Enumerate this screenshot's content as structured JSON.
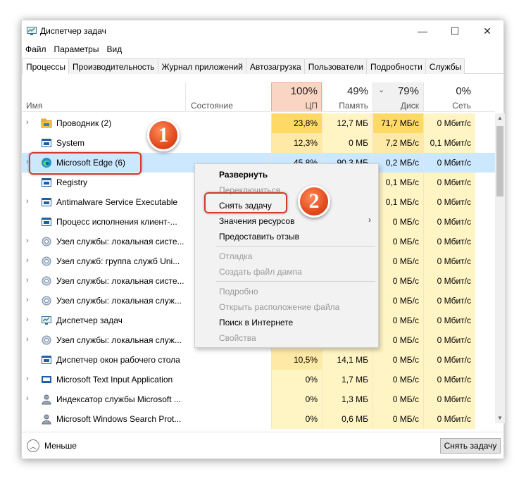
{
  "window": {
    "title": "Диспетчер задач",
    "minimize": "—",
    "maximize": "☐",
    "close": "✕"
  },
  "menu": [
    "Файл",
    "Параметры",
    "Вид"
  ],
  "tabs": [
    "Процессы",
    "Производительность",
    "Журнал приложений",
    "Автозагрузка",
    "Пользователи",
    "Подробности",
    "Службы"
  ],
  "header": {
    "name": "Имя",
    "state": "Состояние",
    "cpu_pct": "100%",
    "cpu": "ЦП",
    "mem_pct": "49%",
    "mem": "Память",
    "disk_pct": "79%",
    "disk": "Диск",
    "net_pct": "0%",
    "net": "Сеть",
    "sort_icon": "chevron-down"
  },
  "rows": [
    {
      "name": "Проводник (2)",
      "icon": "explorer-icon",
      "expand": true,
      "cpu": "23,8%",
      "mem": "12,7 МБ",
      "disk": "71,7 МБ/с",
      "net": "0 Мбит/с"
    },
    {
      "name": "System",
      "icon": "system-icon",
      "expand": false,
      "cpu": "12,3%",
      "mem": "0 МБ",
      "disk": "7,2 МБ/с",
      "net": "0,1 Мбит/с"
    },
    {
      "name": "Microsoft Edge (6)",
      "icon": "edge-icon",
      "expand": true,
      "selected": true,
      "cpu": "45,8%",
      "mem": "90,3 МБ",
      "disk": "0,2 МБ/с",
      "net": "0 Мбит/с"
    },
    {
      "name": "Registry",
      "icon": "system-icon",
      "expand": false,
      "cpu": "",
      "mem": "",
      "disk": "0,1 МБ/с",
      "net": "0 Мбит/с"
    },
    {
      "name": "Antimalware Service Executable",
      "icon": "system-icon",
      "expand": true,
      "cpu": "",
      "mem": "",
      "disk": "0,1 МБ/с",
      "net": "0 Мбит/с"
    },
    {
      "name": "Процесс исполнения клиент-...",
      "icon": "system-icon",
      "expand": false,
      "cpu": "",
      "mem": "",
      "disk": "0 МБ/с",
      "net": "0 Мбит/с"
    },
    {
      "name": "Узел службы: локальная систе...",
      "icon": "gear-icon",
      "expand": true,
      "cpu": "",
      "mem": "",
      "disk": "0 МБ/с",
      "net": "0 Мбит/с"
    },
    {
      "name": "Узел служб: группа служб Uni...",
      "icon": "gear-icon",
      "expand": true,
      "cpu": "",
      "mem": "",
      "disk": "0 МБ/с",
      "net": "0 Мбит/с"
    },
    {
      "name": "Узел службы: локальная систе...",
      "icon": "gear-icon",
      "expand": true,
      "cpu": "",
      "mem": "",
      "disk": "0 МБ/с",
      "net": "0 Мбит/с"
    },
    {
      "name": "Узел службы: локальная служ...",
      "icon": "gear-icon",
      "expand": true,
      "cpu": "",
      "mem": "",
      "disk": "0 МБ/с",
      "net": "0 Мбит/с"
    },
    {
      "name": "Диспетчер задач",
      "icon": "taskmgr-icon",
      "expand": true,
      "cpu": "",
      "mem": "",
      "disk": "0 МБ/с",
      "net": "0 Мбит/с"
    },
    {
      "name": "Узел службы: локальная служ...",
      "icon": "gear-icon",
      "expand": true,
      "cpu": "",
      "mem": "",
      "disk": "0 МБ/с",
      "net": "0 Мбит/с"
    },
    {
      "name": "Диспетчер окон рабочего стола",
      "icon": "system-icon",
      "expand": false,
      "cpu": "10,5%",
      "mem": "14,1 МБ",
      "disk": "0 МБ/с",
      "net": "0 Мбит/с"
    },
    {
      "name": "Microsoft Text Input Application",
      "icon": "keyboard-icon",
      "expand": true,
      "cpu": "0%",
      "mem": "1,7 МБ",
      "disk": "0 МБ/с",
      "net": "0 Мбит/с"
    },
    {
      "name": "Индексатор службы Microsoft ...",
      "icon": "user-icon",
      "expand": true,
      "cpu": "0%",
      "mem": "1,3 МБ",
      "disk": "0 МБ/с",
      "net": "0 Мбит/с"
    },
    {
      "name": "Microsoft Windows Search Prot...",
      "icon": "user-icon",
      "expand": false,
      "cpu": "0%",
      "mem": "0,6 МБ",
      "disk": "0 МБ/с",
      "net": "0 Мбит/с"
    }
  ],
  "context_menu": {
    "expand": "Развернуть",
    "switch": "Переключиться",
    "end_task": "Снять задачу",
    "resource_values": "Значения ресурсов",
    "feedback": "Предоставить отзыв",
    "debug": "Отладка",
    "dump": "Создать файл дампа",
    "details": "Подробно",
    "open_location": "Открыть расположение файла",
    "search_web": "Поиск в Интернете",
    "properties": "Свойства",
    "submenu_arrow": "›"
  },
  "annotations": {
    "badge1": "1",
    "badge2": "2",
    "color": "#d23a2d"
  },
  "footer": {
    "less": "Меньше",
    "end_task": "Снять задачу"
  }
}
